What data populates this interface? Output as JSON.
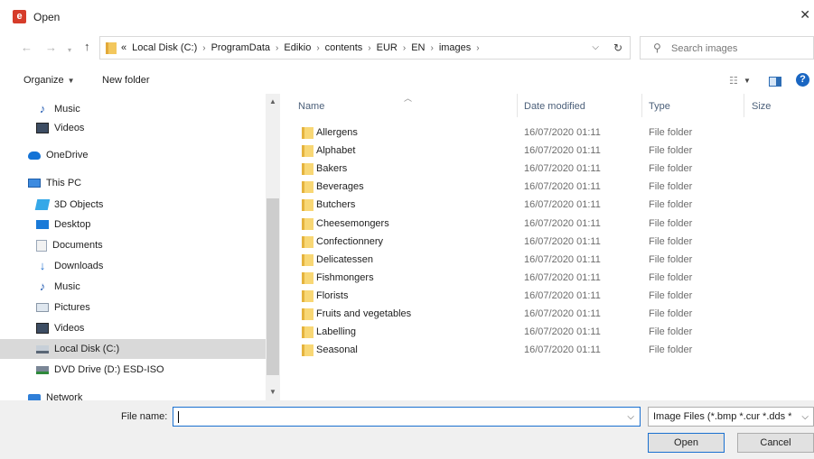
{
  "window": {
    "title": "Open",
    "app_icon_letter": "e"
  },
  "address": {
    "crumb_prefix": "«",
    "breadcrumbs": [
      "Local Disk (C:)",
      "ProgramData",
      "Edikio",
      "contents",
      "EUR",
      "EN",
      "images"
    ]
  },
  "search": {
    "placeholder": "Search images"
  },
  "toolbar": {
    "organize_label": "Organize",
    "new_folder_label": "New folder"
  },
  "nav": {
    "items": [
      {
        "label": "Music",
        "icon": "music-icon"
      },
      {
        "label": "Videos",
        "icon": "videos-icon"
      },
      {
        "label": "OneDrive",
        "icon": "onedrive-icon"
      },
      {
        "label": "This PC",
        "icon": "this-pc-icon"
      },
      {
        "label": "3D Objects",
        "icon": "3d-objects-icon"
      },
      {
        "label": "Desktop",
        "icon": "desktop-icon"
      },
      {
        "label": "Documents",
        "icon": "documents-icon"
      },
      {
        "label": "Downloads",
        "icon": "downloads-icon"
      },
      {
        "label": "Music",
        "icon": "music-icon"
      },
      {
        "label": "Pictures",
        "icon": "pictures-icon"
      },
      {
        "label": "Videos",
        "icon": "videos-icon"
      },
      {
        "label": "Local Disk (C:)",
        "icon": "local-disk-icon",
        "selected": true
      },
      {
        "label": "DVD Drive (D:) ESD-ISO",
        "icon": "dvd-drive-icon"
      },
      {
        "label": "Network",
        "icon": "network-icon"
      }
    ]
  },
  "columns": {
    "name": "Name",
    "date": "Date modified",
    "type": "Type",
    "size": "Size"
  },
  "files": [
    {
      "name": "Allergens",
      "date": "16/07/2020 01:11",
      "type": "File folder"
    },
    {
      "name": "Alphabet",
      "date": "16/07/2020 01:11",
      "type": "File folder"
    },
    {
      "name": "Bakers",
      "date": "16/07/2020 01:11",
      "type": "File folder"
    },
    {
      "name": "Beverages",
      "date": "16/07/2020 01:11",
      "type": "File folder"
    },
    {
      "name": "Butchers",
      "date": "16/07/2020 01:11",
      "type": "File folder"
    },
    {
      "name": "Cheesemongers",
      "date": "16/07/2020 01:11",
      "type": "File folder"
    },
    {
      "name": "Confectionnery",
      "date": "16/07/2020 01:11",
      "type": "File folder"
    },
    {
      "name": "Delicatessen",
      "date": "16/07/2020 01:11",
      "type": "File folder"
    },
    {
      "name": "Fishmongers",
      "date": "16/07/2020 01:11",
      "type": "File folder"
    },
    {
      "name": "Florists",
      "date": "16/07/2020 01:11",
      "type": "File folder"
    },
    {
      "name": "Fruits and vegetables",
      "date": "16/07/2020 01:11",
      "type": "File folder"
    },
    {
      "name": "Labelling",
      "date": "16/07/2020 01:11",
      "type": "File folder"
    },
    {
      "name": "Seasonal",
      "date": "16/07/2020 01:11",
      "type": "File folder"
    }
  ],
  "bottom": {
    "file_name_label": "File name:",
    "file_name_value": "",
    "file_type_filter": "Image Files (*.bmp *.cur *.dds *",
    "open_label": "Open",
    "cancel_label": "Cancel"
  },
  "colors": {
    "accent": "#1a70d0",
    "folder": "#f8d775",
    "selected_row": "#d9d9d9",
    "header_text": "#4c607a"
  }
}
